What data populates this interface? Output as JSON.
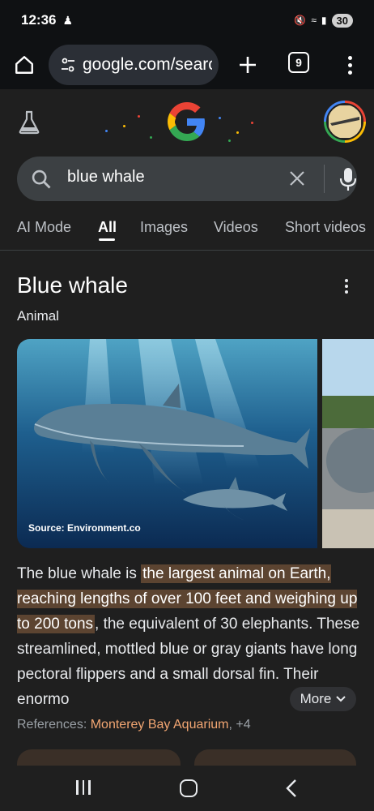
{
  "status_bar": {
    "time": "12:36",
    "battery": "30"
  },
  "browser": {
    "url": "google.com/search",
    "tab_count": "9"
  },
  "search": {
    "query": "blue whale"
  },
  "search_tabs": [
    "AI Mode",
    "All",
    "Images",
    "Videos",
    "Short videos"
  ],
  "active_tab": "All",
  "knowledge_panel": {
    "title": "Blue whale",
    "subtitle": "Animal",
    "image_source": "Source: Environment.co",
    "desc_intro": "The blue whale is ",
    "desc_highlight": "the largest animal on Earth, reaching lengths of over 100 feet and weighing up to 200 tons",
    "desc_rest": ", the equivalent of 30 elephants. These streamlined, mottled blue or gray giants have long pectoral flippers and a small dorsal fin. Their enormo",
    "more_label": "More",
    "refs_label": "References: ",
    "refs_link": "Monterey Bay Aquarium",
    "refs_more": ", +4"
  },
  "colors": {
    "background": "#1f1f1f",
    "search_box": "#3c4043",
    "highlight": "#5c4431",
    "link": "#f2a672"
  }
}
